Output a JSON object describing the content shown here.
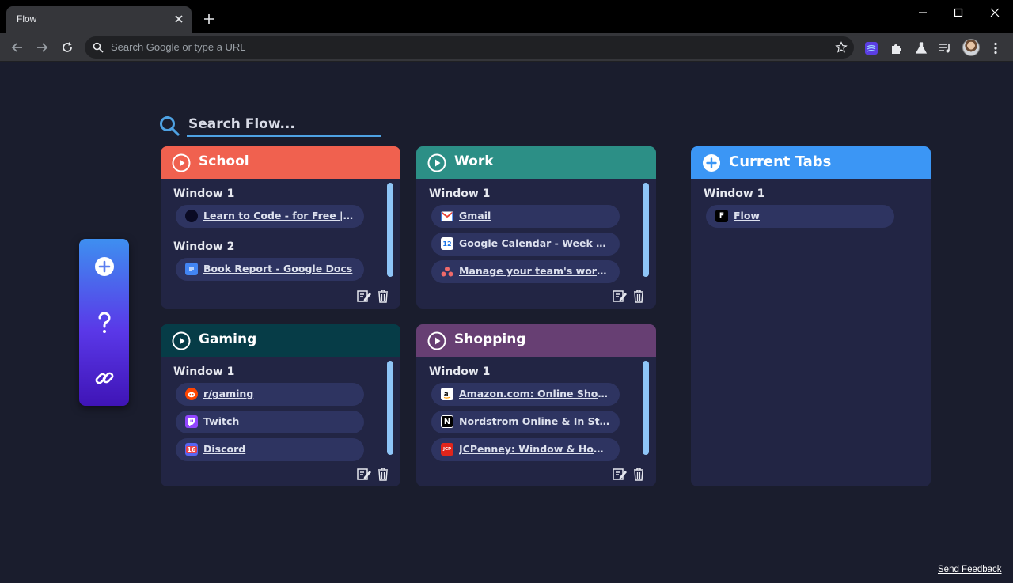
{
  "browser": {
    "tab_title": "Flow",
    "omnibox_placeholder": "Search Google or type a URL"
  },
  "app": {
    "search_placeholder": "Search Flow...",
    "feedback_label": "Send Feedback"
  },
  "groups": [
    {
      "title": "School",
      "color": "#f0614f",
      "windows": [
        {
          "label": "Window 1",
          "tabs": [
            {
              "title": "Learn to Code - for Free | C...",
              "icon": "freecodecamp-icon"
            }
          ]
        },
        {
          "label": "Window 2",
          "tabs": [
            {
              "title": "Book Report - Google Docs",
              "icon": "google-docs-icon"
            }
          ]
        }
      ]
    },
    {
      "title": "Work",
      "color": "#2c8f86",
      "windows": [
        {
          "label": "Window 1",
          "tabs": [
            {
              "title": "Gmail",
              "icon": "gmail-icon"
            },
            {
              "title": "Google Calendar - Week of ...",
              "icon": "google-calendar-icon"
            },
            {
              "title": "Manage your team's work, p...",
              "icon": "asana-icon"
            }
          ]
        }
      ]
    },
    {
      "title": "Gaming",
      "color": "#063c47",
      "windows": [
        {
          "label": "Window 1",
          "tabs": [
            {
              "title": "r/gaming",
              "icon": "reddit-icon"
            },
            {
              "title": "Twitch",
              "icon": "twitch-icon"
            },
            {
              "title": "Discord",
              "icon": "discord-icon"
            }
          ]
        }
      ]
    },
    {
      "title": "Shopping",
      "color": "#673f73",
      "windows": [
        {
          "label": "Window 1",
          "tabs": [
            {
              "title": "Amazon.com: Online Shopp...",
              "icon": "amazon-icon"
            },
            {
              "title": "Nordstrom Online & In Stor...",
              "icon": "nordstrom-icon"
            },
            {
              "title": "JCPenney: Window & Home...",
              "icon": "jcpenney-icon"
            }
          ]
        }
      ]
    }
  ],
  "current": {
    "title": "Current Tabs",
    "color": "#3b96f5",
    "windows": [
      {
        "label": "Window 1",
        "tabs": [
          {
            "title": "Flow",
            "icon": "flow-icon"
          }
        ]
      }
    ]
  },
  "icon_glyphs": {
    "discord_badge": "16",
    "nordstrom_letter": "N",
    "flow_letter": "F",
    "jcpenney_letters": "JCP"
  }
}
